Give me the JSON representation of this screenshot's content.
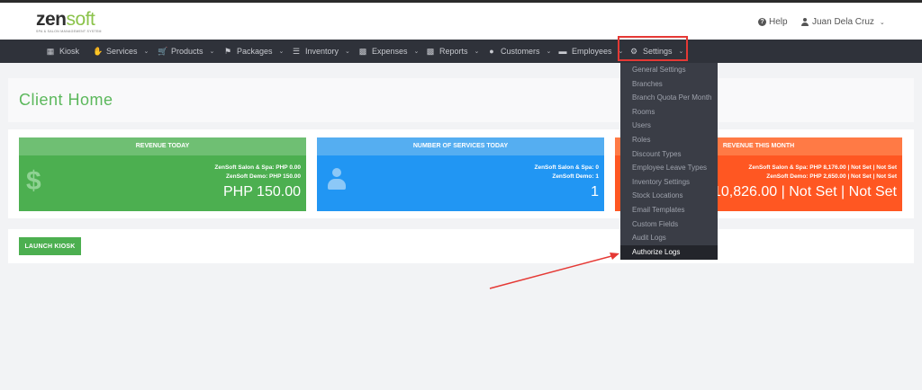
{
  "header": {
    "logo_zen": "zen",
    "logo_soft": "soft",
    "logo_tagline": "SPA & SALON MANAGEMENT SYSTEM",
    "help_label": "Help",
    "user_name": "Juan Dela Cruz"
  },
  "nav": {
    "items": [
      {
        "label": "Kiosk",
        "icon": "kiosk-icon"
      },
      {
        "label": "Services",
        "icon": "hand-icon"
      },
      {
        "label": "Products",
        "icon": "cart-icon"
      },
      {
        "label": "Packages",
        "icon": "tag-icon"
      },
      {
        "label": "Inventory",
        "icon": "list-icon"
      },
      {
        "label": "Expenses",
        "icon": "card-icon"
      },
      {
        "label": "Reports",
        "icon": "bar-chart-icon"
      },
      {
        "label": "Customers",
        "icon": "users-icon"
      },
      {
        "label": "Employees",
        "icon": "id-card-icon"
      },
      {
        "label": "Settings",
        "icon": "gear-icon"
      }
    ]
  },
  "settings_menu": {
    "items": [
      "General Settings",
      "Branches",
      "Branch Quota Per Month",
      "Rooms",
      "Users",
      "Roles",
      "Discount Types",
      "Employee Leave Types",
      "Inventory Settings",
      "Stock Locations",
      "Email Templates",
      "Custom Fields",
      "Audit Logs",
      "Authorize Logs"
    ],
    "active": "Authorize Logs"
  },
  "page": {
    "title": "Client Home",
    "launch_kiosk": "LAUNCH KIOSK"
  },
  "cards": {
    "revenue_today": {
      "title": "REVENUE TODAY",
      "line1": "ZenSoft Salon & Spa: PHP 0.00",
      "line2": "ZenSoft Demo: PHP 150.00",
      "total": "PHP 150.00"
    },
    "services_today": {
      "title": "NUMBER OF SERVICES TODAY",
      "line1": "ZenSoft Salon & Spa: 0",
      "line2": "ZenSoft Demo: 1",
      "total": "1"
    },
    "revenue_month": {
      "title": "REVENUE THIS MONTH",
      "line1": "ZenSoft Salon & Spa: PHP 8,176.00 | Not Set | Not Set",
      "line2": "ZenSoft Demo: PHP 2,650.00 | Not Set | Not Set",
      "total": "PHP 10,826.00 | Not Set | Not Set"
    }
  },
  "colors": {
    "accent_green": "#4caf50",
    "accent_blue": "#2196f3",
    "accent_orange": "#ff5722",
    "nav_bg": "#2f323a",
    "highlight_red": "#e53935"
  }
}
